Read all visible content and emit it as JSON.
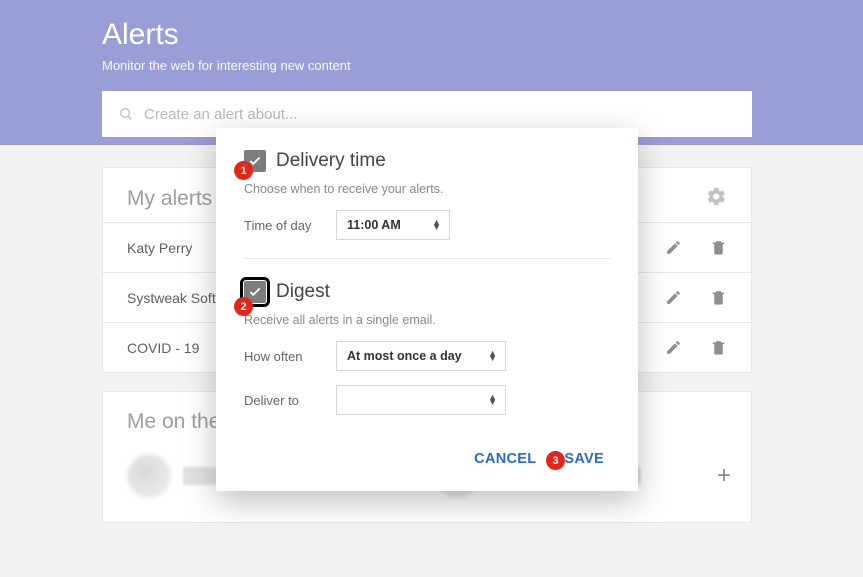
{
  "hero": {
    "title": "Alerts",
    "subtitle": "Monitor the web for interesting new content",
    "search_placeholder": "Create an alert about..."
  },
  "alerts_card": {
    "heading": "My alerts",
    "items": [
      {
        "name": "Katy Perry"
      },
      {
        "name": "Systweak Software"
      },
      {
        "name": "COVID - 19"
      }
    ]
  },
  "me_card": {
    "heading": "Me on the"
  },
  "modal": {
    "delivery": {
      "title": "Delivery time",
      "desc": "Choose when to receive your alerts.",
      "time_label": "Time of day",
      "time_value": "11:00 AM",
      "checked": true
    },
    "digest": {
      "title": "Digest",
      "desc": "Receive all alerts in a single email.",
      "often_label": "How often",
      "often_value": "At most once a day",
      "deliver_label": "Deliver to",
      "deliver_value": "",
      "checked": true
    },
    "cancel": "CANCEL",
    "save": "SAVE"
  },
  "callouts": {
    "b1": "1",
    "b2": "2",
    "b3": "3"
  }
}
